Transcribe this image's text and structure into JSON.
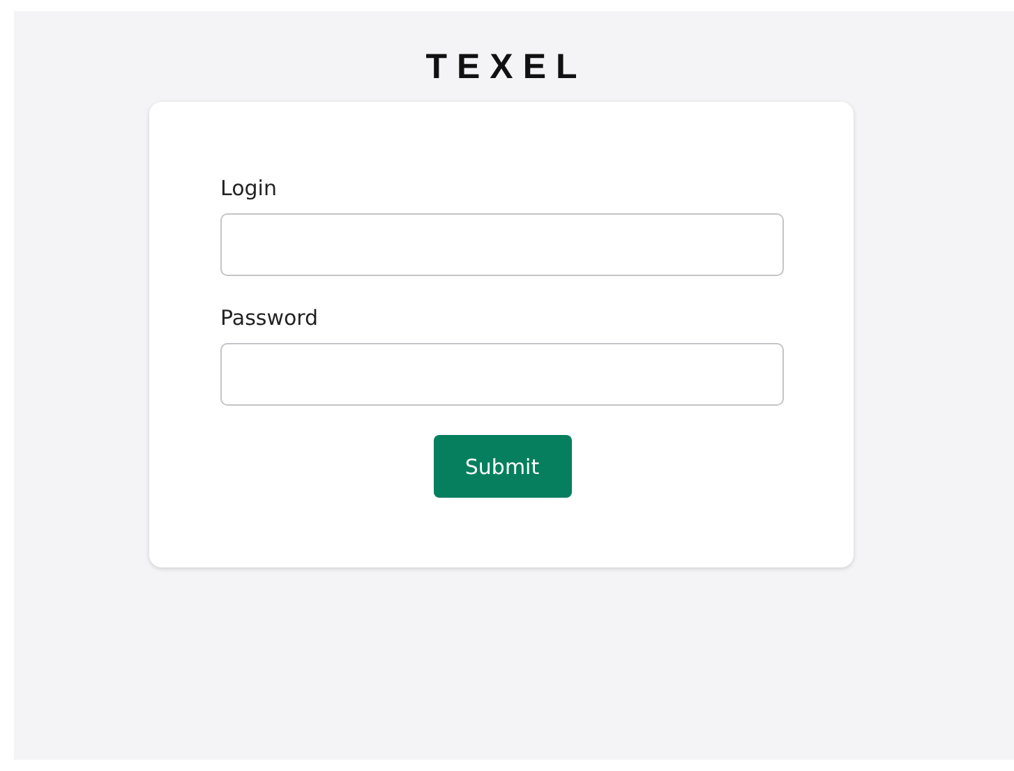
{
  "logo": "TEXEL",
  "form": {
    "fields": [
      {
        "label": "Login"
      },
      {
        "label": "Password"
      }
    ],
    "submit": "Submit"
  }
}
